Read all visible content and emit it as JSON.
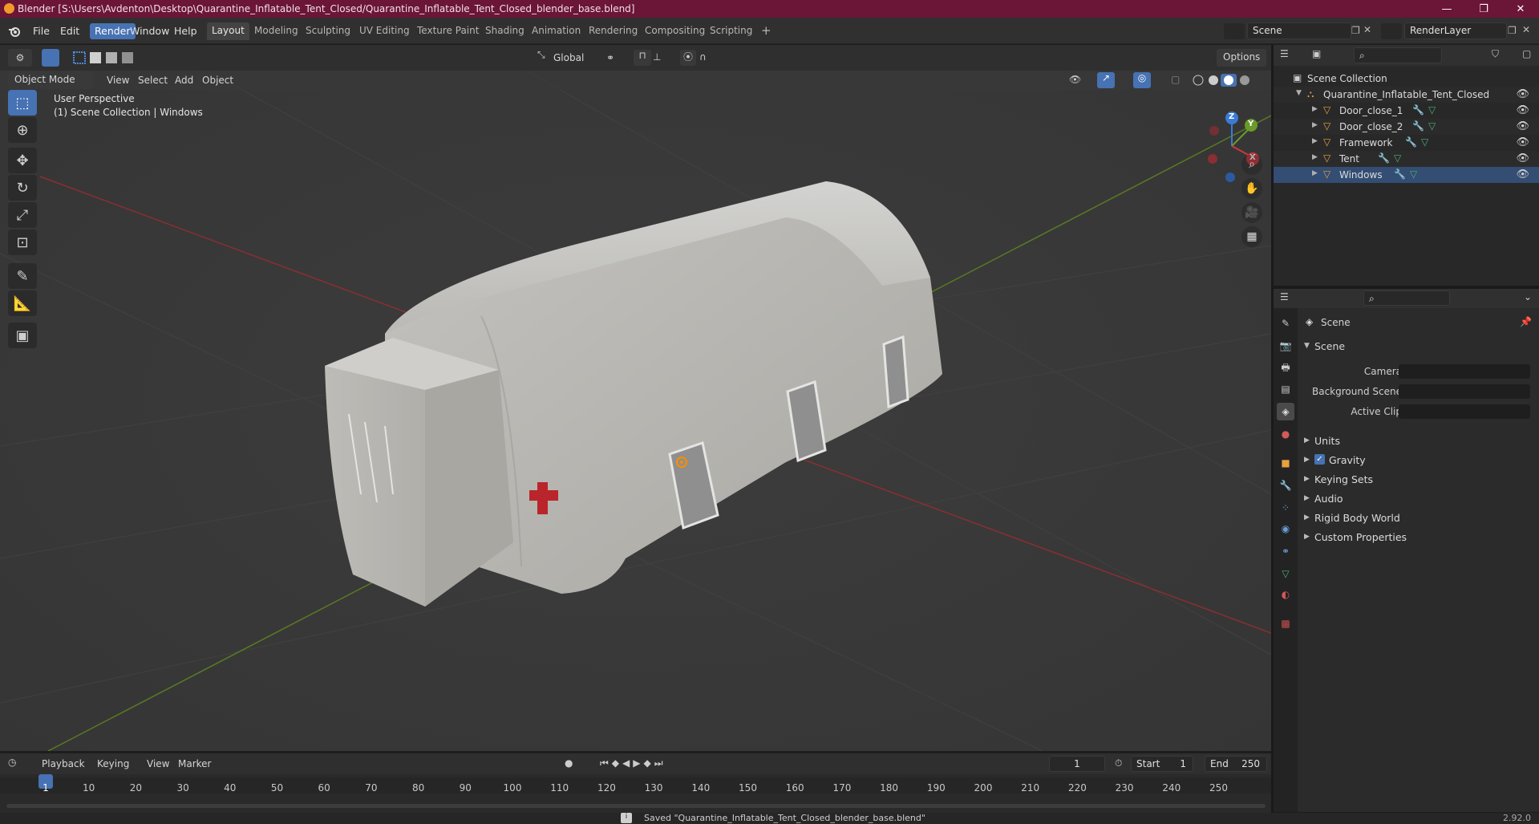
{
  "window": {
    "title": "Blender [S:\\Users\\Avdenton\\Desktop\\Quarantine_Inflatable_Tent_Closed/Quarantine_Inflatable_Tent_Closed_blender_base.blend]",
    "minimize": "—",
    "maximize": "❐",
    "close": "✕"
  },
  "menu": {
    "items": [
      "File",
      "Edit",
      "Render",
      "Window",
      "Help"
    ],
    "active": "Render"
  },
  "workspaces": {
    "tabs": [
      "Layout",
      "Modeling",
      "Sculpting",
      "UV Editing",
      "Texture Paint",
      "Shading",
      "Animation",
      "Rendering",
      "Compositing",
      "Scripting"
    ],
    "active": "Layout",
    "add": "+"
  },
  "scene_selector": {
    "value": "Scene"
  },
  "layer_selector": {
    "value": "RenderLayer"
  },
  "viewport": {
    "mode": "Object Mode",
    "menus": [
      "View",
      "Select",
      "Add",
      "Object"
    ],
    "transform_orientation": "Global",
    "options": "Options",
    "perspective": "User Perspective",
    "collection_info": "(1) Scene Collection | Windows",
    "gizmo_axes": {
      "x": "X",
      "y": "Y",
      "z": "Z"
    }
  },
  "outliner": {
    "search_placeholder": "",
    "root": "Scene Collection",
    "collection": "Quarantine_Inflatable_Tent_Closed",
    "objects": [
      "Door_close_1",
      "Door_close_2",
      "Framework",
      "Tent",
      "Windows"
    ]
  },
  "properties": {
    "breadcrumb": "Scene",
    "panel_title": "Scene",
    "fields": [
      {
        "label": "Camera"
      },
      {
        "label": "Background Scene"
      },
      {
        "label": "Active Clip"
      }
    ],
    "sections": [
      "Units",
      "Gravity",
      "Keying Sets",
      "Audio",
      "Rigid Body World",
      "Custom Properties"
    ],
    "gravity_checked": true
  },
  "timeline": {
    "menus": [
      "Playback",
      "Keying",
      "View",
      "Marker"
    ],
    "current_frame": "1",
    "start_label": "Start",
    "start": "1",
    "end_label": "End",
    "end": "250",
    "ticks": [
      "1",
      "10",
      "20",
      "30",
      "40",
      "50",
      "60",
      "70",
      "80",
      "90",
      "100",
      "110",
      "120",
      "130",
      "140",
      "150",
      "160",
      "170",
      "180",
      "190",
      "200",
      "210",
      "220",
      "230",
      "240",
      "250"
    ]
  },
  "status": {
    "message": "Saved \"Quarantine_Inflatable_Tent_Closed_blender_base.blend\"",
    "version": "2.92.0"
  },
  "colors": {
    "title_bar": "#6b1537",
    "accent": "#4772b3",
    "x_axis": "#c9393f",
    "y_axis": "#6a9a2a",
    "z_axis": "#3a7bd5"
  }
}
